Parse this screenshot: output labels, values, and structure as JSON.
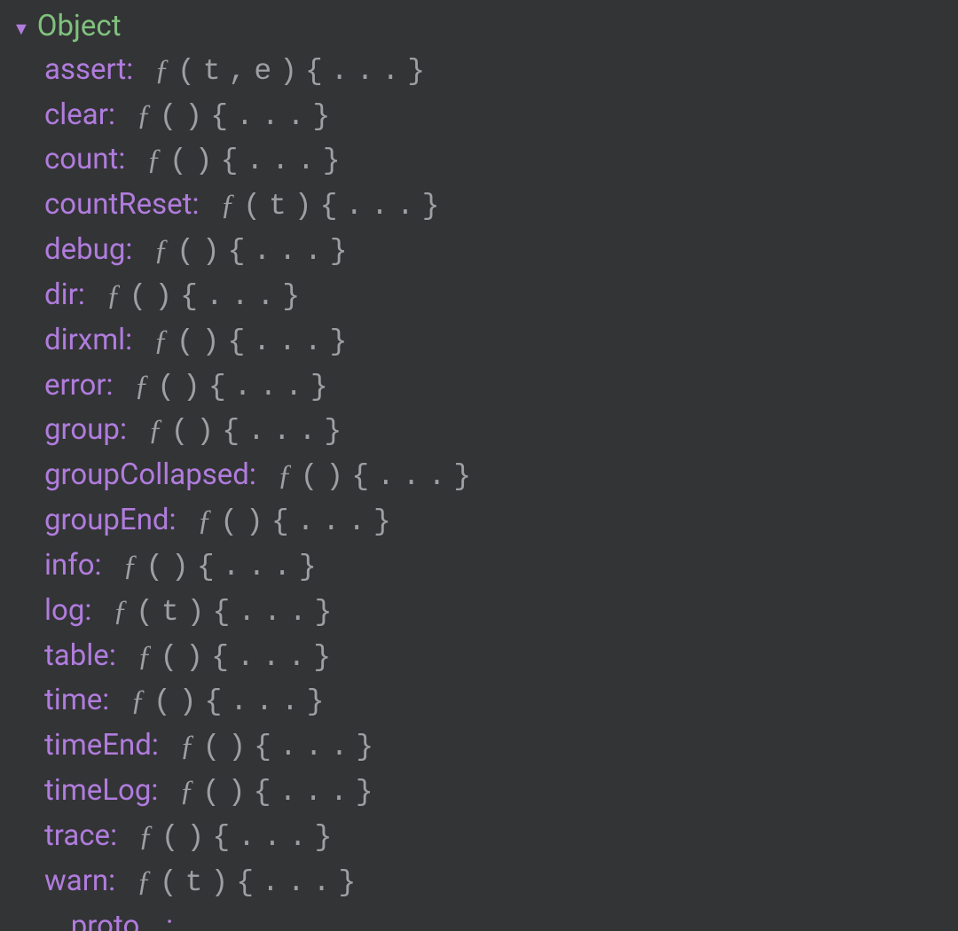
{
  "header": {
    "label": "Object"
  },
  "properties": [
    {
      "name": "assert",
      "signature": "(t,e){...}"
    },
    {
      "name": "clear",
      "signature": "(){...}"
    },
    {
      "name": "count",
      "signature": "(){...}"
    },
    {
      "name": "countReset",
      "signature": "(t){...}"
    },
    {
      "name": "debug",
      "signature": "(){...}"
    },
    {
      "name": "dir",
      "signature": "(){...}"
    },
    {
      "name": "dirxml",
      "signature": "(){...}"
    },
    {
      "name": "error",
      "signature": "(){...}"
    },
    {
      "name": "group",
      "signature": "(){...}"
    },
    {
      "name": "groupCollapsed",
      "signature": "(){...}"
    },
    {
      "name": "groupEnd",
      "signature": "(){...}"
    },
    {
      "name": "info",
      "signature": "(){...}"
    },
    {
      "name": "log",
      "signature": "(t){...}"
    },
    {
      "name": "table",
      "signature": "(){...}"
    },
    {
      "name": "time",
      "signature": "(){...}"
    },
    {
      "name": "timeEnd",
      "signature": "(){...}"
    },
    {
      "name": "timeLog",
      "signature": "(){...}"
    },
    {
      "name": "trace",
      "signature": "(){...}"
    },
    {
      "name": "warn",
      "signature": "(t){...}"
    }
  ],
  "proto": {
    "name": "__proto__",
    "link": "…"
  },
  "fsymbol": "ƒ"
}
